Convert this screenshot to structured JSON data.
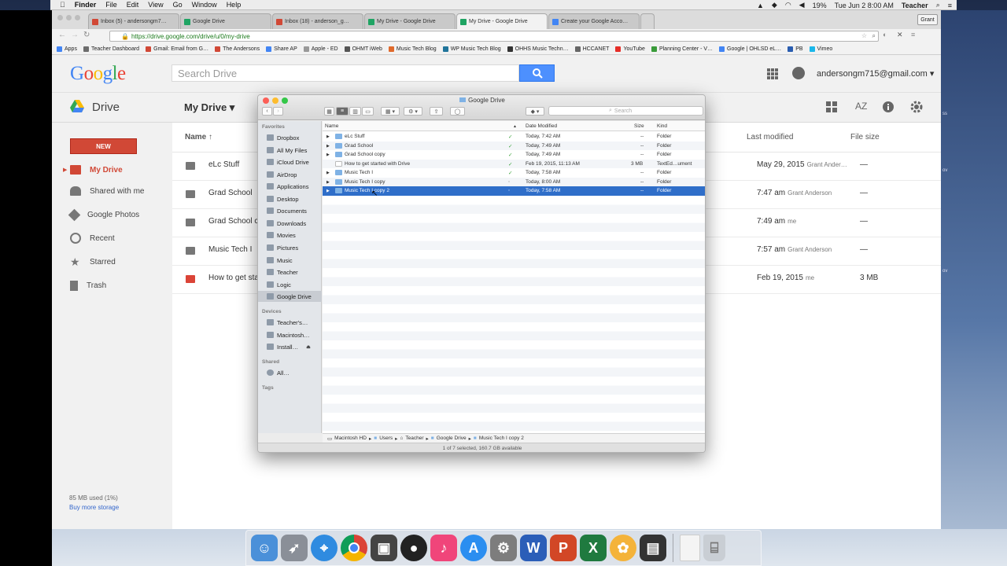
{
  "menubar": {
    "app": "Finder",
    "items": [
      "File",
      "Edit",
      "View",
      "Go",
      "Window",
      "Help"
    ],
    "battery": "19%",
    "clock": "Tue Jun 2  8:00 AM",
    "user": "Teacher"
  },
  "browser": {
    "tabs": [
      {
        "label": "Inbox (5) - andersongm7…",
        "color": "#d14836",
        "active": false
      },
      {
        "label": "Google Drive",
        "color": "#1fa463",
        "active": false
      },
      {
        "label": "Inbox (18) - anderson_g…",
        "color": "#d14836",
        "active": false
      },
      {
        "label": "My Drive - Google Drive",
        "color": "#1fa463",
        "active": false
      },
      {
        "label": "My Drive - Google Drive",
        "color": "#1fa463",
        "active": true
      },
      {
        "label": "Create your Google Acco…",
        "color": "#4285f4",
        "active": false
      }
    ],
    "profile": "Grant",
    "url": "https://drive.google.com/drive/u/0/my-drive",
    "bookmarks": [
      {
        "label": "Apps",
        "color": "#4285f4"
      },
      {
        "label": "Teacher Dashboard",
        "color": "#6d6d6d"
      },
      {
        "label": "Gmail: Email from G…",
        "color": "#d14836"
      },
      {
        "label": "The Andersons",
        "color": "#d14836"
      },
      {
        "label": "Share AP",
        "color": "#4285f4"
      },
      {
        "label": "Apple - ED",
        "color": "#999999"
      },
      {
        "label": "OHMT iWeb",
        "color": "#555555"
      },
      {
        "label": "Music Tech Blog",
        "color": "#e06a2c"
      },
      {
        "label": "WP Music Tech Blog",
        "color": "#21759b"
      },
      {
        "label": "OHHS Music Techn…",
        "color": "#333333"
      },
      {
        "label": "HCCANET",
        "color": "#666666"
      },
      {
        "label": "YouTube",
        "color": "#e52d27"
      },
      {
        "label": "Planning Center - V…",
        "color": "#3a9b3a"
      },
      {
        "label": "Google | OHLSD eL…",
        "color": "#4285f4"
      },
      {
        "label": "PB",
        "color": "#2a5db0"
      },
      {
        "label": "Vimeo",
        "color": "#1ab7ea"
      }
    ]
  },
  "drive": {
    "search_placeholder": "Search Drive",
    "account": "andersongm715@gmail.com ▾",
    "app_label": "Drive",
    "title": "My Drive ▾",
    "new_label": "NEW",
    "sidebar": [
      {
        "label": "My Drive",
        "icon": "drive-folder-icon",
        "active": true
      },
      {
        "label": "Shared with me",
        "icon": "people-icon",
        "active": false
      },
      {
        "label": "Google Photos",
        "icon": "pinwheel-icon",
        "active": false
      },
      {
        "label": "Recent",
        "icon": "clock-icon",
        "active": false
      },
      {
        "label": "Starred",
        "icon": "star-icon",
        "active": false
      },
      {
        "label": "Trash",
        "icon": "trash-icon",
        "active": false
      }
    ],
    "storage_used": "85 MB used (1%)",
    "buy_storage": "Buy more storage",
    "columns": {
      "name": "Name ↑",
      "modified": "Last modified",
      "size": "File size"
    },
    "files": [
      {
        "name": "eLc Stuff",
        "date": "May 29, 2015",
        "who": "Grant Ander…",
        "size": "—",
        "type": "shared-folder"
      },
      {
        "name": "Grad School",
        "date": "7:47 am",
        "who": "Grant Anderson",
        "size": "—",
        "type": "shared-folder"
      },
      {
        "name": "Grad School co",
        "date": "7:49 am",
        "who": "me",
        "size": "—",
        "type": "folder"
      },
      {
        "name": "Music Tech I",
        "date": "7:57 am",
        "who": "Grant Anderson",
        "size": "—",
        "type": "shared-folder"
      },
      {
        "name": "How to get sta",
        "date": "Feb 19, 2015",
        "who": "me",
        "size": "3 MB",
        "type": "pdf"
      }
    ]
  },
  "finder": {
    "title": "Google Drive",
    "search_placeholder": "Search",
    "sidebar": {
      "favorites_label": "Favorites",
      "favorites": [
        "Dropbox",
        "All My Files",
        "iCloud Drive",
        "AirDrop",
        "Applications",
        "Desktop",
        "Documents",
        "Downloads",
        "Movies",
        "Pictures",
        "Music",
        "Teacher",
        "Logic",
        "Google Drive"
      ],
      "devices_label": "Devices",
      "devices": [
        "Teacher's…",
        "Macintosh…",
        "Install…"
      ],
      "shared_label": "Shared",
      "shared": [
        "All…"
      ],
      "tags_label": "Tags"
    },
    "columns": {
      "name": "Name",
      "date": "Date Modified",
      "size": "Size",
      "kind": "Kind"
    },
    "rows": [
      {
        "name": "eLc Stuff",
        "status": "✓",
        "date": "Today, 7:42 AM",
        "size": "--",
        "kind": "Folder",
        "folder": true
      },
      {
        "name": "Grad School",
        "status": "✓",
        "date": "Today, 7:49 AM",
        "size": "--",
        "kind": "Folder",
        "folder": true
      },
      {
        "name": "Grad School copy",
        "status": "✓",
        "date": "Today, 7:49 AM",
        "size": "--",
        "kind": "Folder",
        "folder": true
      },
      {
        "name": "How to get started with Drive",
        "status": "✓",
        "date": "Feb 19, 2015, 11:13 AM",
        "size": "3 MB",
        "kind": "TextEd…ument",
        "folder": false
      },
      {
        "name": "Music Tech I",
        "status": "✓",
        "date": "Today, 7:58 AM",
        "size": "--",
        "kind": "Folder",
        "folder": true
      },
      {
        "name": "Music Tech I copy",
        "status": "◦",
        "date": "Today, 8:00 AM",
        "size": "--",
        "kind": "Folder",
        "folder": true
      },
      {
        "name": "Music Tech I copy 2",
        "status": "◦",
        "date": "Today, 7:58 AM",
        "size": "--",
        "kind": "Folder",
        "folder": true,
        "selected": true
      }
    ],
    "path": [
      "Macintosh HD",
      "Users",
      "Teacher",
      "Google Drive",
      "Music Tech I copy 2"
    ],
    "status": "1 of 7 selected, 160.7 GB available"
  },
  "dock": [
    {
      "name": "finder",
      "color": "#4a90d9",
      "glyph": "☺"
    },
    {
      "name": "launchpad",
      "color": "#8a8f98",
      "glyph": "🚀"
    },
    {
      "name": "safari",
      "color": "#2f8be0",
      "glyph": "⌖"
    },
    {
      "name": "chrome",
      "color": "#e8c33a",
      "glyph": "◉"
    },
    {
      "name": "logic",
      "color": "#444444",
      "glyph": "▣"
    },
    {
      "name": "record",
      "color": "#222222",
      "glyph": "●"
    },
    {
      "name": "itunes",
      "color": "#f0457a",
      "glyph": "♪"
    },
    {
      "name": "app-store",
      "color": "#2b8ef0",
      "glyph": "A"
    },
    {
      "name": "system-preferences",
      "color": "#7d7d7d",
      "glyph": "⚙"
    },
    {
      "name": "word",
      "color": "#2b5eb8",
      "glyph": "W"
    },
    {
      "name": "powerpoint",
      "color": "#d24726",
      "glyph": "P"
    },
    {
      "name": "excel",
      "color": "#1f7a3f",
      "glyph": "X"
    },
    {
      "name": "photos",
      "color": "#f4b33a",
      "glyph": "✿"
    },
    {
      "name": "imovie",
      "color": "#333333",
      "glyph": "▤"
    },
    {
      "name": "document",
      "color": "#f4f4f4",
      "glyph": ""
    },
    {
      "name": "trash",
      "color": "#c9ced4",
      "glyph": "🗑"
    }
  ]
}
